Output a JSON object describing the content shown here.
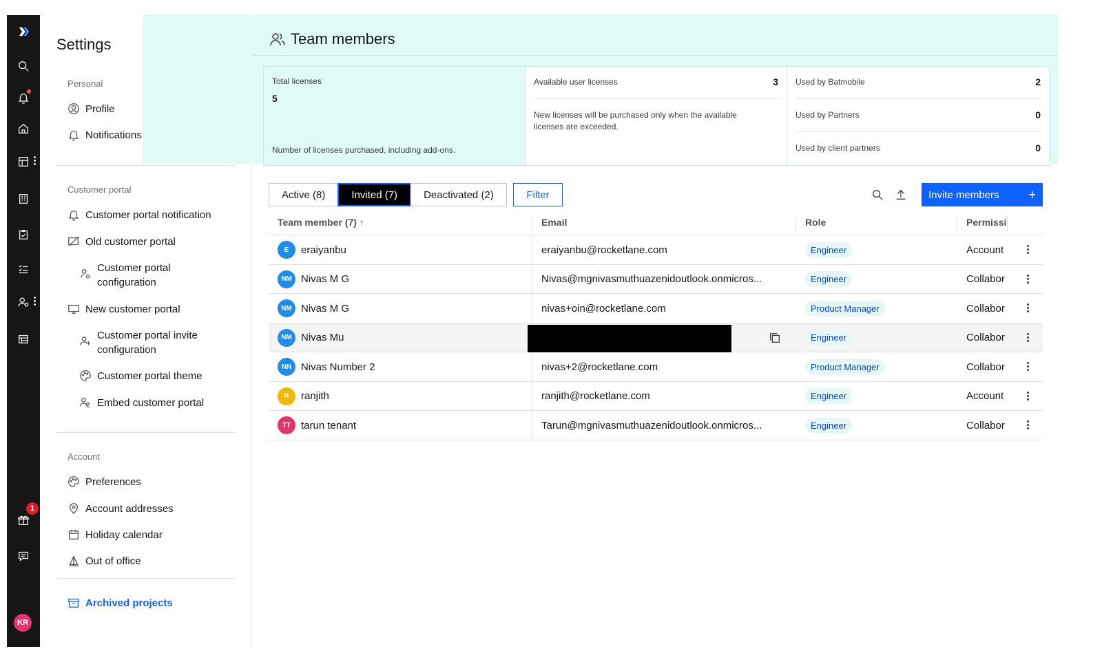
{
  "rail": {
    "items": [
      "logo-icon",
      "search-icon",
      "bell-icon",
      "home-icon",
      "dashboard-icon",
      "building-icon",
      "clipboard-icon",
      "checklist-icon",
      "users-icon",
      "template-icon",
      "gift-icon",
      "chat-icon"
    ],
    "gift_badge": "1",
    "avatar_initials": "KR"
  },
  "settings": {
    "title": "Settings",
    "personal_label": "Personal",
    "profile": "Profile",
    "notifications": "Notifications",
    "customer_portal_label": "Customer portal",
    "cp_notification": "Customer portal notification",
    "old_portal": "Old customer portal",
    "cp_config": "Customer portal configuration",
    "new_portal": "New customer portal",
    "cp_invite_config": "Customer portal invite configuration",
    "cp_theme": "Customer portal theme",
    "embed_portal": "Embed customer portal",
    "account_label": "Account",
    "preferences": "Preferences",
    "addresses": "Account addresses",
    "holiday": "Holiday calendar",
    "ooo": "Out of office",
    "archived": "Archived projects"
  },
  "header": {
    "title": "Team members"
  },
  "licenses": {
    "total_label": "Total licenses",
    "total_value": "5",
    "total_note": "Number of licenses purchased, including add-ons.",
    "available_label": "Available user licenses",
    "available_value": "3",
    "available_note": "New licenses will be purchased only when the available licenses are exceeded.",
    "batmobile_label": "Used by Batmobile",
    "batmobile_value": "2",
    "partners_label": "Used by Partners",
    "partners_value": "0",
    "client_label": "Used by client partners",
    "client_value": "0"
  },
  "tabs": {
    "active": "Active (8)",
    "invited": "Invited (7)",
    "deactivated": "Deactivated (2)",
    "filter": "Filter",
    "invite": "Invite members",
    "invite_plus": "+"
  },
  "table": {
    "headers": {
      "member": "Team member (7) ↑",
      "email": "Email",
      "role": "Role",
      "permission": "Permissi"
    },
    "rows": [
      {
        "initials": "E",
        "color": "#1f8ceb",
        "name": "eraiyanbu",
        "email": "eraiyanbu@rocketlane.com",
        "role": "Engineer",
        "perm": "Account"
      },
      {
        "initials": "NM",
        "color": "#1f8ceb",
        "name": "Nivas M G",
        "email": "Nivas@mgnivasmuthuazenidoutlook.onmicros...",
        "role": "Engineer",
        "perm": "Collabora"
      },
      {
        "initials": "NM",
        "color": "#1f8ceb",
        "name": "Nivas M G",
        "email": "nivas+oin@rocketlane.com",
        "role": "Product Manager",
        "perm": "Collabora"
      },
      {
        "initials": "NM",
        "color": "#1f8ceb",
        "name": "Nivas Mu",
        "email": "",
        "role": "Engineer",
        "perm": "Collabora"
      },
      {
        "initials": "NN",
        "color": "#1f8ceb",
        "name": "Nivas Number 2",
        "email": "nivas+2@rocketlane.com",
        "role": "Product Manager",
        "perm": "Collabora"
      },
      {
        "initials": "R",
        "color": "#f5b800",
        "name": "ranjith",
        "email": "ranjith@rocketlane.com",
        "role": "Engineer",
        "perm": "Account"
      },
      {
        "initials": "TT",
        "color": "#e4336f",
        "name": "tarun tenant",
        "email": "Tarun@mgnivasmuthuazenidoutlook.onmicros...",
        "role": "Engineer",
        "perm": "Collabora"
      }
    ]
  }
}
